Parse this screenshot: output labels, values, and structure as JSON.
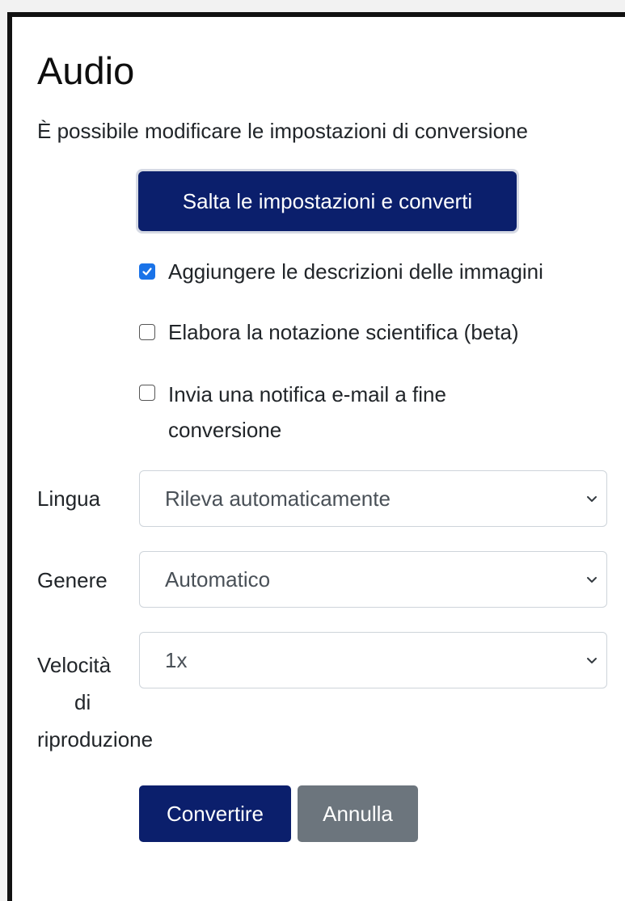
{
  "dialog": {
    "title": "Audio",
    "subtitle": "È possibile modificare le impostazioni di conversione"
  },
  "skip_button": {
    "label": "Salta le impostazioni e converti"
  },
  "options": [
    {
      "label": "Aggiungere le descrizioni delle immagini",
      "checked": true
    },
    {
      "label": "Elabora la notazione scientifica (beta)",
      "checked": false
    },
    {
      "label": "Invia una notifica e-mail a fine conversione",
      "label_line1": "Invia una notifica e-mail a fine",
      "label_line2": "conversione",
      "checked": false
    }
  ],
  "fields": {
    "language": {
      "label": "Lingua",
      "value": "Rileva automaticamente"
    },
    "gender": {
      "label": "Genere",
      "value": "Automatico"
    },
    "speed": {
      "label_line1": "Velocità",
      "label_line2": "di",
      "label_line3": "riproduzione",
      "value": "1x"
    }
  },
  "actions": {
    "convert_label": "Convertire",
    "cancel_label": "Annulla"
  },
  "colors": {
    "primary": "#0b1f6c",
    "secondary": "#6c757d",
    "checkbox_accent": "#1a73e8"
  },
  "icons": {
    "checkbox_checked": "checkmark-icon",
    "select_arrow": "chevron-down-icon"
  }
}
